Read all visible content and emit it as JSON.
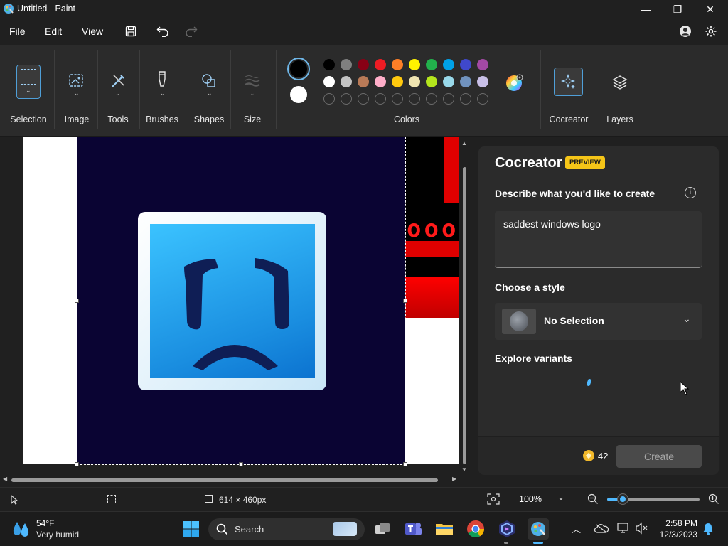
{
  "window": {
    "title": "Untitled - Paint",
    "minimize_glyph": "—",
    "maximize_glyph": "❐",
    "close_glyph": "✕"
  },
  "menu": {
    "file": "File",
    "edit": "Edit",
    "view": "View"
  },
  "ribbon": {
    "groups": {
      "selection": "Selection",
      "image": "Image",
      "tools": "Tools",
      "brushes": "Brushes",
      "shapes": "Shapes",
      "size": "Size",
      "colors": "Colors",
      "cocreator": "Cocreator",
      "layers": "Layers"
    },
    "primary_color": "#000000",
    "secondary_color": "#ffffff",
    "palette_row1": [
      "#000000",
      "#7f7f7f",
      "#880015",
      "#ed1c24",
      "#ff7f27",
      "#fff200",
      "#22b14c",
      "#00a2e8",
      "#3f48cc",
      "#a349a4"
    ],
    "palette_row2": [
      "#ffffff",
      "#c3c3c3",
      "#b97a57",
      "#ffaec9",
      "#ffc90e",
      "#efe4b0",
      "#b5e61d",
      "#99d9ea",
      "#7092be",
      "#c8bfe7"
    ]
  },
  "canvas": {
    "image_background": "#0a0433",
    "logo_color": "#1ea7ec",
    "selection_border": "dashed"
  },
  "cocreator": {
    "title": "Cocreator",
    "badge": "PREVIEW",
    "describe_label": "Describe what you'd like to create",
    "prompt_value": "saddest windows logo",
    "style_label": "Choose a style",
    "style_value": "No Selection",
    "variants_label": "Explore variants",
    "credits": "42",
    "create_button": "Create"
  },
  "status": {
    "canvas_size": "614 × 460px",
    "zoom": "100%",
    "zoom_level": 0.17
  },
  "taskbar": {
    "weather_temp": "54°F",
    "weather_desc": "Very humid",
    "search_placeholder": "Search",
    "time": "2:58 PM",
    "date": "12/3/2023"
  }
}
